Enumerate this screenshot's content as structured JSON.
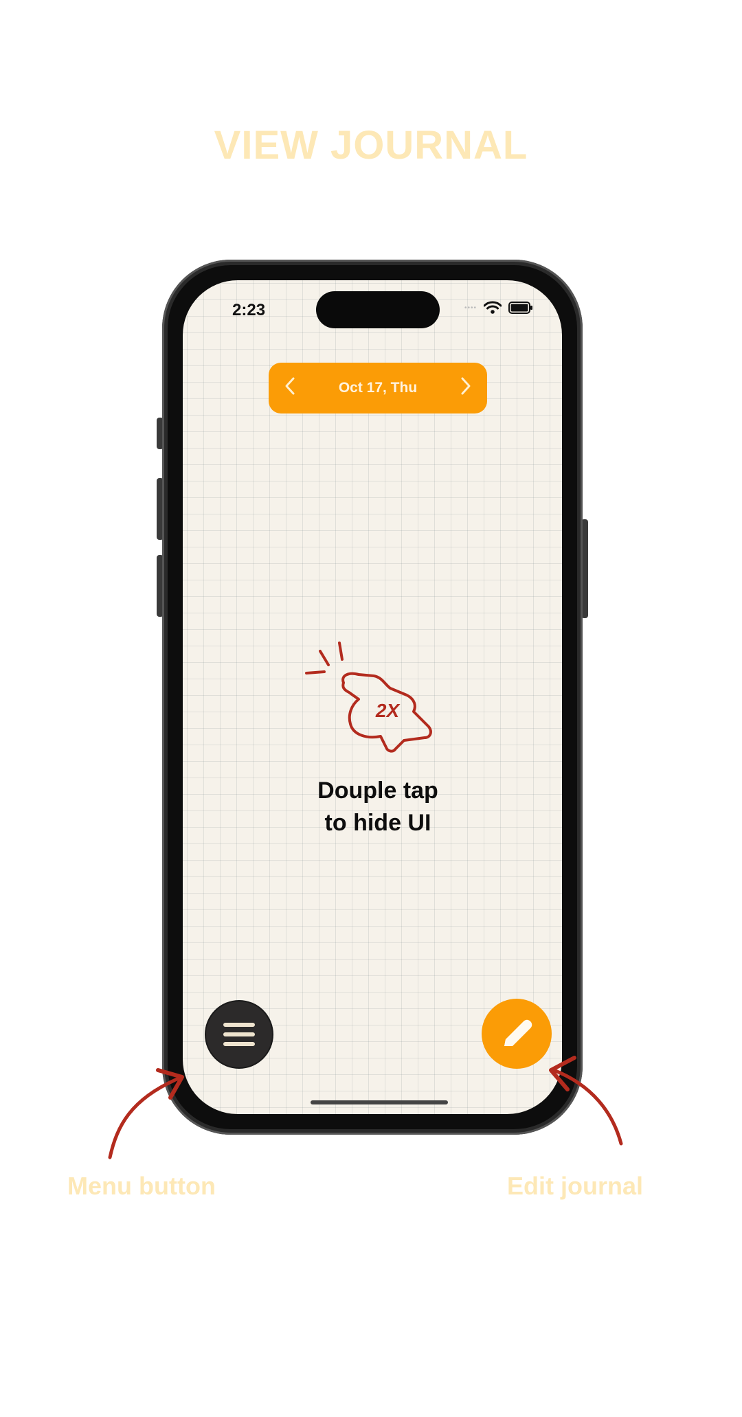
{
  "page": {
    "title": "VIEW JOURNAL"
  },
  "status_bar": {
    "time": "2:23",
    "wifi_icon": "wifi-icon",
    "battery_icon": "battery-icon"
  },
  "date_nav": {
    "label": "Oct 17, Thu",
    "prev_icon": "chevron-left-icon",
    "next_icon": "chevron-right-icon"
  },
  "hint": {
    "line1": "Douple tap",
    "line2": "to hide UI",
    "badge": "2X"
  },
  "buttons": {
    "menu_icon": "hamburger-menu-icon",
    "edit_icon": "pencil-icon"
  },
  "captions": {
    "menu": "Menu button",
    "edit": "Edit journal"
  },
  "colors": {
    "accent": "#fb9c06",
    "caption": "#fde8b6",
    "annotation": "#b32b1e",
    "paper": "#f6f2ea"
  }
}
